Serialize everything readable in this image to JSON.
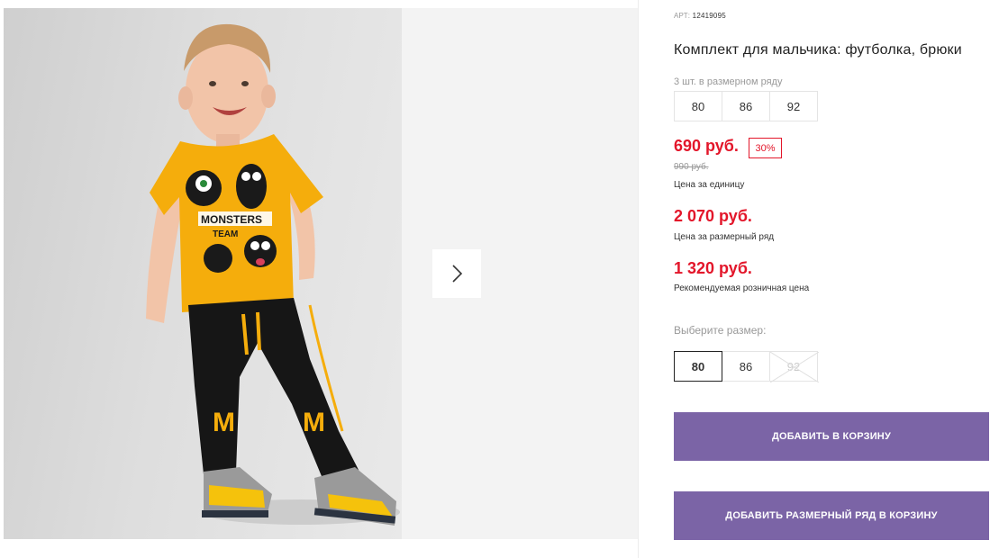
{
  "product": {
    "article_label": "АРТ:",
    "article_value": "12419095",
    "title": "Комплект для мальчика: футболка, брюки",
    "row_info": "3 шт. в размерном ряду",
    "row_sizes": [
      "80",
      "86",
      "92"
    ]
  },
  "pricing": {
    "unit_price": "690 руб.",
    "discount": "30%",
    "old_price": "990 руб.",
    "unit_caption": "Цена за единицу",
    "row_price": "2 070 руб.",
    "row_caption": "Цена за размерный ряд",
    "retail_price": "1 320 руб.",
    "retail_caption": "Рекомендуемая розничная цена"
  },
  "size_picker": {
    "label": "Выберите размер:",
    "options": [
      {
        "label": "80",
        "state": "selected"
      },
      {
        "label": "86",
        "state": "available"
      },
      {
        "label": "92",
        "state": "unavailable"
      }
    ]
  },
  "actions": {
    "add_to_cart": "ДОБАВИТЬ В КОРЗИНУ",
    "add_row_to_cart": "ДОБАВИТЬ РАЗМЕРНЫЙ РЯД В КОРЗИНУ"
  },
  "gallery": {
    "next_icon": "chevron-right-icon",
    "photo_print_text_line1": "MONSTERS",
    "photo_print_text_line2": "TEAM",
    "photo_pants_letter": "M"
  },
  "colors": {
    "price_red": "#e3162a",
    "button_purple": "#7b64a6",
    "shirt_yellow": "#f5ad0c"
  }
}
